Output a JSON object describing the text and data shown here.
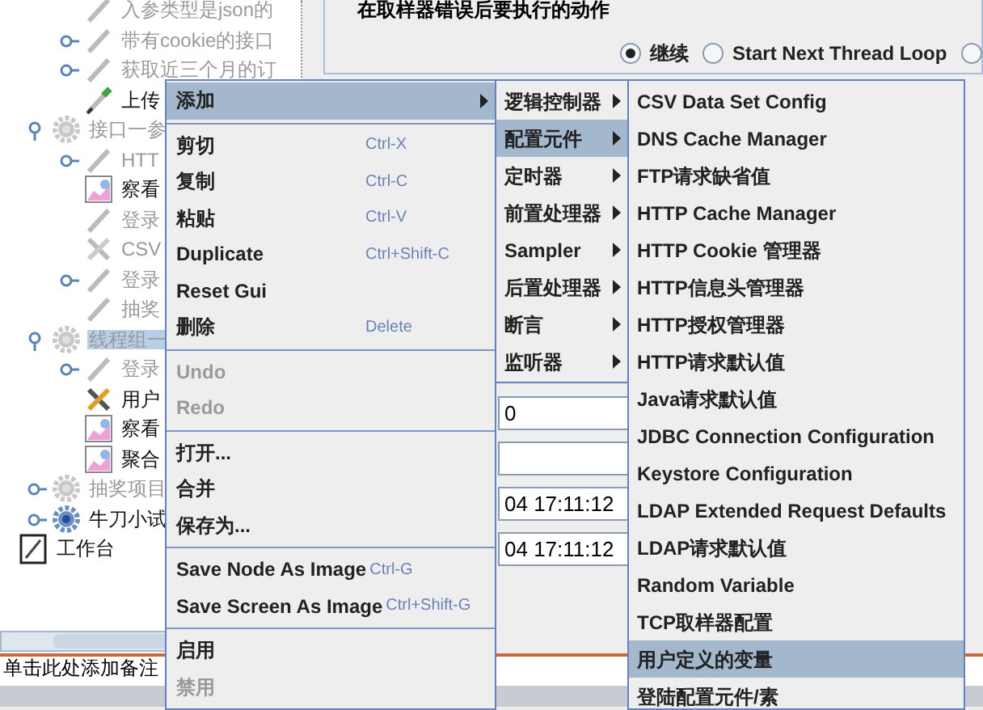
{
  "tree": {
    "partial_children": [
      {
        "label": "入参类型是json的",
        "kind": "pen",
        "enabled": false,
        "selected": false
      },
      {
        "label": "带有cookie的接口",
        "kind": "pen",
        "enabled": false,
        "selected": false,
        "expanded": false
      },
      {
        "label": "获取近三个月的订",
        "kind": "pen",
        "enabled": false,
        "selected": false,
        "expanded": false
      },
      {
        "label": "上传",
        "kind": "pen",
        "enabled": true,
        "selected": false
      }
    ],
    "groups": [
      {
        "label": "接口一参",
        "kind": "gear",
        "enabled": false,
        "selected": false,
        "expanded": true,
        "children": [
          {
            "label": "HTT",
            "kind": "pen",
            "enabled": false,
            "selected": false,
            "expanded": false
          },
          {
            "label": "察看",
            "kind": "graph",
            "enabled": true,
            "selected": false
          },
          {
            "label": "登录",
            "kind": "pen",
            "enabled": false,
            "selected": false
          },
          {
            "label": "CSV",
            "kind": "tools",
            "enabled": false,
            "selected": false
          },
          {
            "label": "登录",
            "kind": "pen",
            "enabled": false,
            "selected": false,
            "expanded": false
          },
          {
            "label": "抽奖",
            "kind": "pen",
            "enabled": false,
            "selected": false
          }
        ]
      },
      {
        "label": "线程组一",
        "kind": "gear",
        "enabled": false,
        "selected": true,
        "expanded": true,
        "children": [
          {
            "label": "登录",
            "kind": "pen",
            "enabled": false,
            "selected": false,
            "expanded": false
          },
          {
            "label": "用户",
            "kind": "tools",
            "enabled": true,
            "selected": false
          },
          {
            "label": "察看",
            "kind": "graph",
            "enabled": true,
            "selected": false
          },
          {
            "label": "聚合",
            "kind": "graph",
            "enabled": true,
            "selected": false
          }
        ]
      },
      {
        "label": "抽奖项目",
        "kind": "gear",
        "enabled": false,
        "selected": false,
        "expanded": false
      },
      {
        "label": "牛刀小试",
        "kind": "gear",
        "enabled": true,
        "selected": false,
        "expanded": false
      }
    ],
    "workbench": {
      "label": "工作台",
      "kind": "notepad",
      "enabled": true,
      "selected": false
    }
  },
  "error_action": {
    "title": "在取样器错误后要执行的动作",
    "options": [
      {
        "label": "继续",
        "selected": true
      },
      {
        "label": "Start Next Thread Loop",
        "selected": false
      },
      {
        "selected": false
      }
    ]
  },
  "fields": [
    {
      "kind": "input",
      "value": "0"
    },
    {
      "kind": "input"
    },
    {
      "kind": "input",
      "value": "04 17:11:12"
    },
    {
      "kind": "input",
      "value": "04 17:11:12"
    }
  ],
  "comment": "单击此处添加备注",
  "context_menu": [
    {
      "kind": "item",
      "label": "添加",
      "submenu": true,
      "selected": true,
      "disabled": false
    },
    {
      "kind": "separator"
    },
    {
      "kind": "item",
      "label": "剪切",
      "shortcut": "Ctrl-X",
      "selected": false,
      "disabled": false
    },
    {
      "kind": "item",
      "label": "复制",
      "shortcut": "Ctrl-C",
      "selected": false,
      "disabled": false
    },
    {
      "kind": "item",
      "label": "粘贴",
      "shortcut": "Ctrl-V",
      "selected": false,
      "disabled": false
    },
    {
      "kind": "item",
      "label": "Duplicate",
      "shortcut": "Ctrl+Shift-C",
      "selected": false,
      "disabled": false
    },
    {
      "kind": "item",
      "label": "Reset Gui",
      "selected": false,
      "disabled": false
    },
    {
      "kind": "item",
      "label": "删除",
      "shortcut": "Delete",
      "selected": false,
      "disabled": false
    },
    {
      "kind": "separator"
    },
    {
      "kind": "item",
      "label": "Undo",
      "selected": false,
      "disabled": true
    },
    {
      "kind": "item",
      "label": "Redo",
      "selected": false,
      "disabled": true
    },
    {
      "kind": "separator"
    },
    {
      "kind": "item",
      "label": "打开...",
      "selected": false,
      "disabled": false
    },
    {
      "kind": "item",
      "label": "合并",
      "selected": false,
      "disabled": false
    },
    {
      "kind": "item",
      "label": "保存为...",
      "selected": false,
      "disabled": false
    },
    {
      "kind": "separator"
    },
    {
      "kind": "item",
      "label": "Save Node As Image",
      "shortcut": "Ctrl-G",
      "selected": false,
      "disabled": false
    },
    {
      "kind": "item",
      "label": "Save Screen As Image",
      "shortcut": "Ctrl+Shift-G",
      "selected": false,
      "disabled": false
    },
    {
      "kind": "separator"
    },
    {
      "kind": "item",
      "label": "启用",
      "selected": false,
      "disabled": false
    },
    {
      "kind": "item",
      "label": "禁用",
      "selected": false,
      "disabled": true
    }
  ],
  "add_submenu": [
    {
      "label": "逻辑控制器",
      "selected": false
    },
    {
      "label": "配置元件",
      "selected": true
    },
    {
      "label": "定时器",
      "selected": false
    },
    {
      "label": "前置处理器",
      "selected": false
    },
    {
      "label": "Sampler",
      "selected": false
    },
    {
      "label": "后置处理器",
      "selected": false
    },
    {
      "label": "断言",
      "selected": false
    },
    {
      "label": "监听器",
      "selected": false
    }
  ],
  "config_submenu": [
    {
      "label": "CSV Data Set Config",
      "selected": false
    },
    {
      "label": "DNS Cache Manager",
      "selected": false
    },
    {
      "label": "FTP请求缺省值",
      "selected": false
    },
    {
      "label": "HTTP Cache Manager",
      "selected": false
    },
    {
      "label": "HTTP Cookie 管理器",
      "selected": false
    },
    {
      "label": "HTTP信息头管理器",
      "selected": false
    },
    {
      "label": "HTTP授权管理器",
      "selected": false
    },
    {
      "label": "HTTP请求默认值",
      "selected": false
    },
    {
      "label": "Java请求默认值",
      "selected": false
    },
    {
      "label": "JDBC Connection Configuration",
      "selected": false
    },
    {
      "label": "Keystore Configuration",
      "selected": false
    },
    {
      "label": "LDAP Extended Request Defaults",
      "selected": false
    },
    {
      "label": "LDAP请求默认值",
      "selected": false
    },
    {
      "label": "Random Variable",
      "selected": false
    },
    {
      "label": "TCP取样器配置",
      "selected": false
    },
    {
      "label": "用户定义的变量",
      "selected": true
    },
    {
      "label": "登陆配置元件/素",
      "selected": false
    }
  ]
}
